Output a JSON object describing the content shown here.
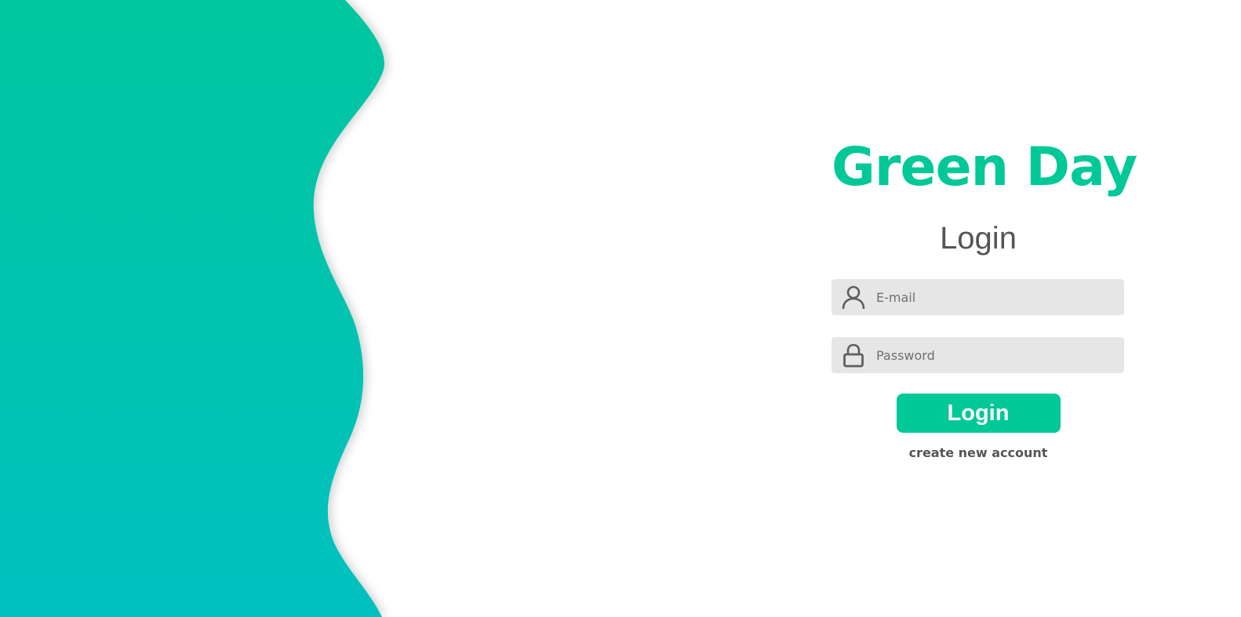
{
  "colors": {
    "brand": "#00c897",
    "wave_top": "#00c69f",
    "wave_bottom": "#00c1bf",
    "text_gray": "#555555",
    "field_bg": "#e6e6e6"
  },
  "brand": {
    "title": "Green Day"
  },
  "login_form": {
    "heading": "Login",
    "email": {
      "placeholder": "E-mail",
      "value": "",
      "icon": "user-icon"
    },
    "password": {
      "placeholder": "Password",
      "value": "",
      "icon": "lock-icon"
    },
    "submit_label": "Login",
    "create_account_label": "create new account"
  }
}
